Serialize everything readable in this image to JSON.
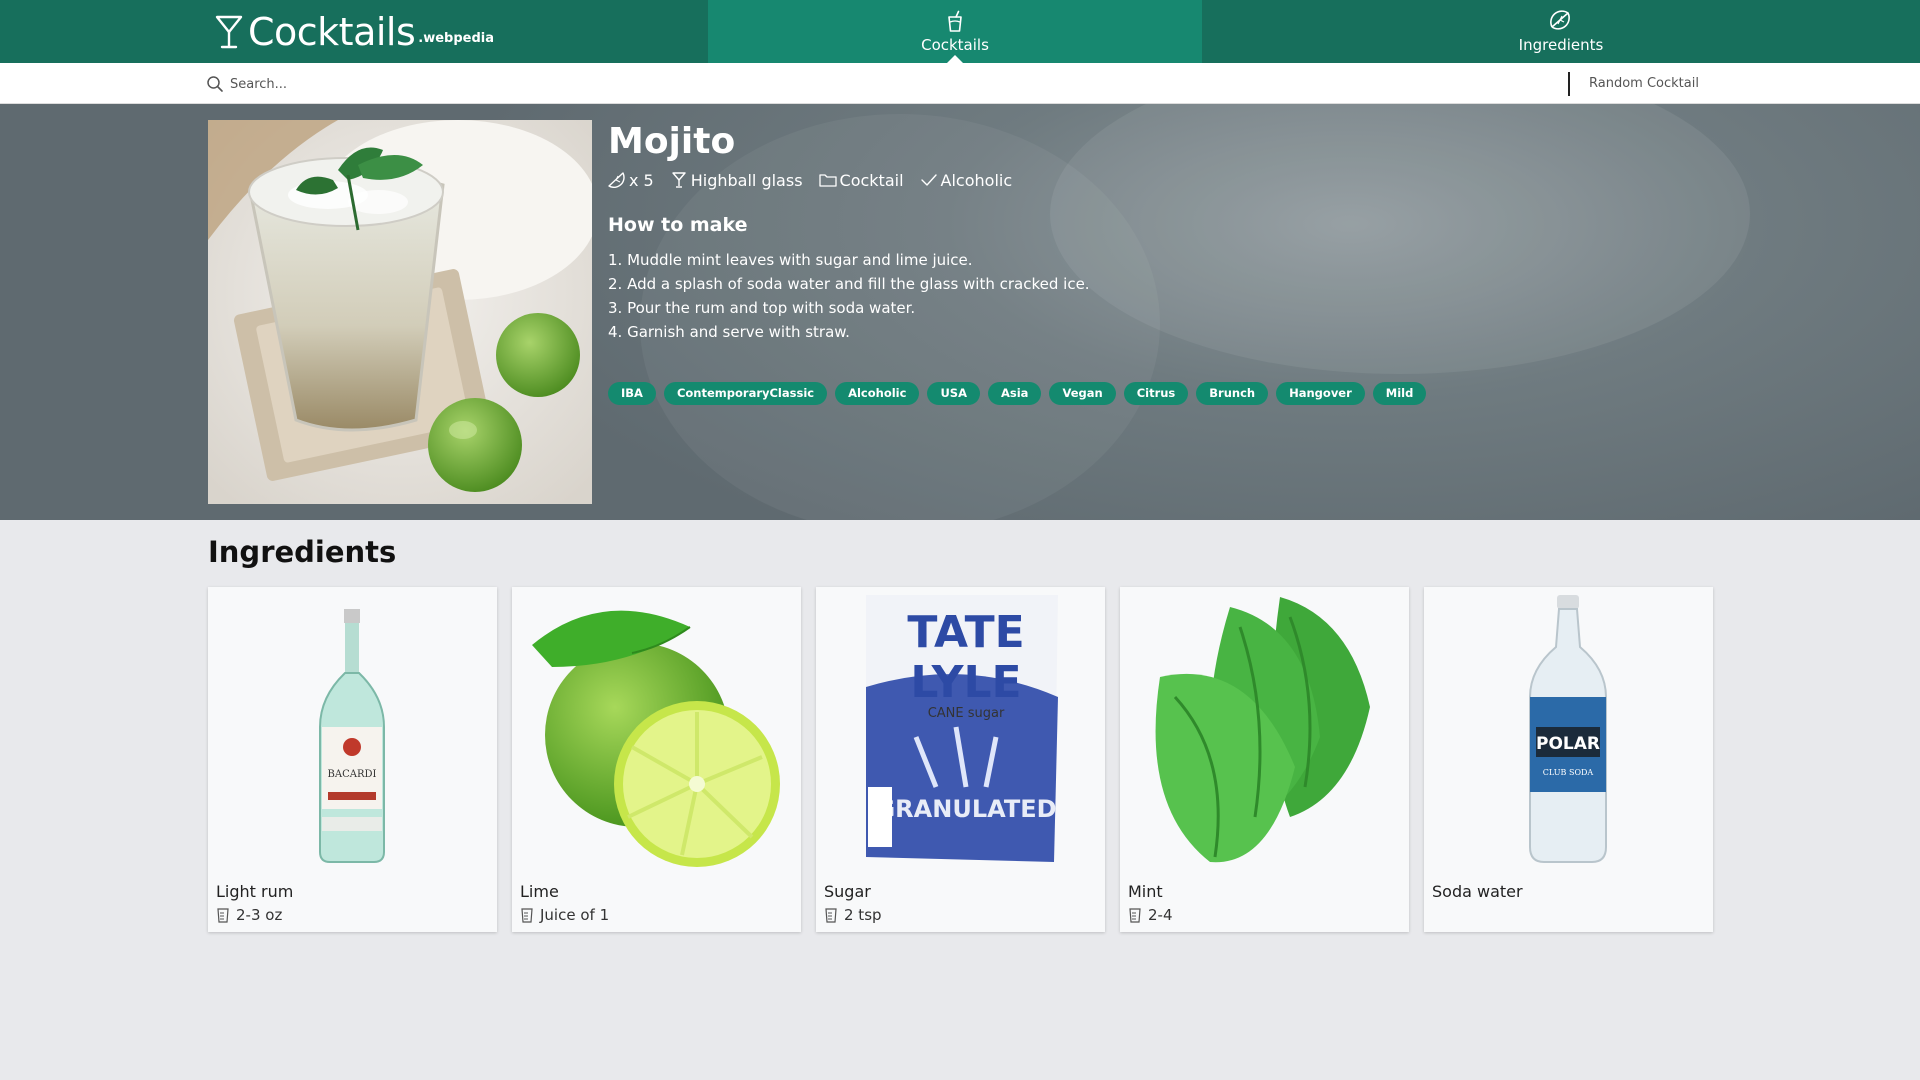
{
  "brand": {
    "title": "Cocktails",
    "subtitle": ".webpedia"
  },
  "nav": {
    "cocktails_label": "Cocktails",
    "ingredients_label": "Ingredients"
  },
  "search": {
    "placeholder": "Search...",
    "random_label": "Random Cocktail"
  },
  "drink": {
    "name": "Mojito",
    "servings": "x 5",
    "glass": "Highball glass",
    "category": "Cocktail",
    "alcoholic": "Alcoholic",
    "howto_heading": "How to make",
    "steps": [
      "1. Muddle mint leaves with sugar and lime juice.",
      "2. Add a splash of soda water and fill the glass with cracked ice.",
      "3. Pour the rum and top with soda water.",
      "4. Garnish and serve with straw."
    ],
    "tags": [
      "IBA",
      "ContemporaryClassic",
      "Alcoholic",
      "USA",
      "Asia",
      "Vegan",
      "Citrus",
      "Brunch",
      "Hangover",
      "Mild"
    ]
  },
  "ingredients": {
    "heading": "Ingredients",
    "items": [
      {
        "name": "Light rum",
        "amount": "2-3 oz"
      },
      {
        "name": "Lime",
        "amount": "Juice of 1"
      },
      {
        "name": "Sugar",
        "amount": "2 tsp"
      },
      {
        "name": "Mint",
        "amount": "2-4"
      },
      {
        "name": "Soda water",
        "amount": ""
      }
    ]
  },
  "colors": {
    "header": "#176f5c",
    "active_tab": "#178870",
    "tag": "#148a6f",
    "background": "#e8e9ec"
  }
}
